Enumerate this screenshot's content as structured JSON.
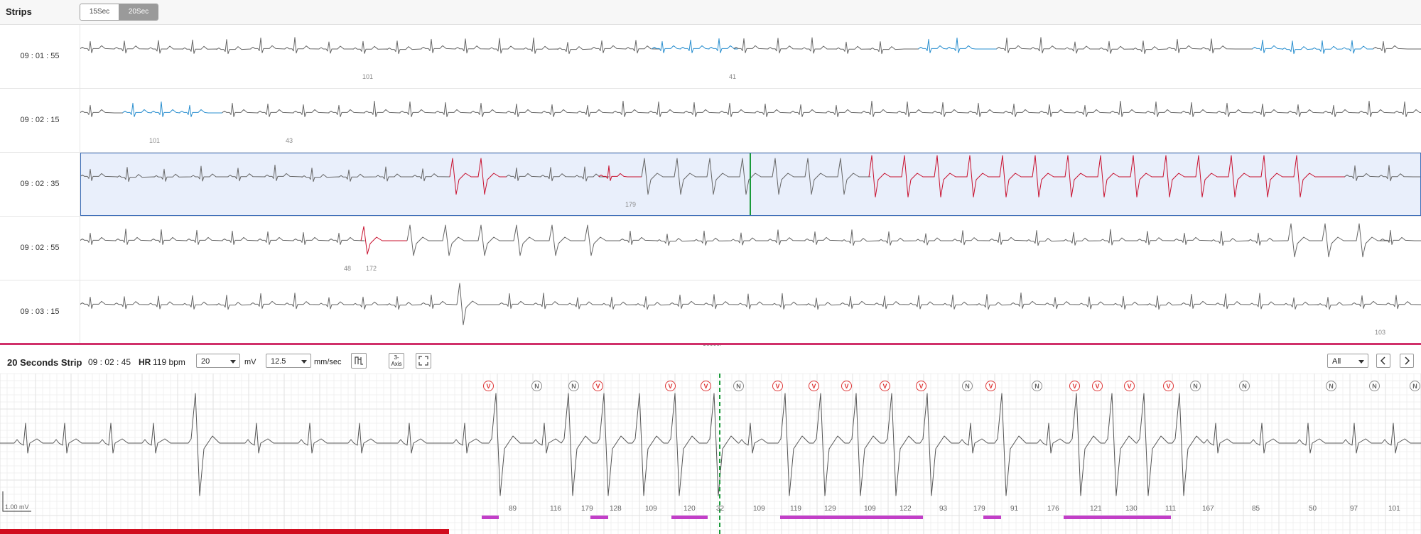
{
  "header": {
    "title": "Strips",
    "seg_15": "15Sec",
    "seg_20": "20Sec"
  },
  "strips": [
    {
      "time": "09 : 01 : 55",
      "beats": [
        "101",
        "41"
      ]
    },
    {
      "time": "09 : 02 : 15",
      "beats": [
        "101",
        "43"
      ]
    },
    {
      "time": "09 : 02 : 35",
      "beats": [
        "179"
      ]
    },
    {
      "time": "09 : 02 : 55",
      "beats": [
        "48",
        "172"
      ]
    },
    {
      "time": "09 : 03 : 15",
      "beats": [
        "103"
      ]
    }
  ],
  "toolbar": {
    "title": "20 Seconds Strip",
    "time": "09 : 02 : 45",
    "hr_label": "HR",
    "hr_value": "119 bpm",
    "gain_value": "20",
    "gain_unit": "mV",
    "speed_value": "12.5",
    "speed_unit": "mm/sec",
    "axis_label": "3-Axis",
    "filter_value": "All"
  },
  "detail": {
    "scale_label": "1.00 mV",
    "beat_labels": [
      "V",
      "N",
      "N",
      "V",
      "V",
      "V",
      "N",
      "V",
      "V",
      "V",
      "V",
      "V",
      "N",
      "V",
      "N",
      "V",
      "V",
      "V",
      "V",
      "N",
      "N",
      "N",
      "N",
      "N"
    ],
    "rr_values": [
      "89",
      "116",
      "179",
      "128",
      "109",
      "120",
      "32",
      "109",
      "119",
      "129",
      "109",
      "122",
      "93",
      "179",
      "91",
      "176",
      "121",
      "130",
      "111",
      "167",
      "85",
      "50",
      "97",
      "101"
    ]
  },
  "colors": {
    "normal": "#666666",
    "blue": "#2a8fcf",
    "red": "#c8102e",
    "select": "#e9effb",
    "accent": "#d0306a",
    "segment": "#c23fc8"
  }
}
